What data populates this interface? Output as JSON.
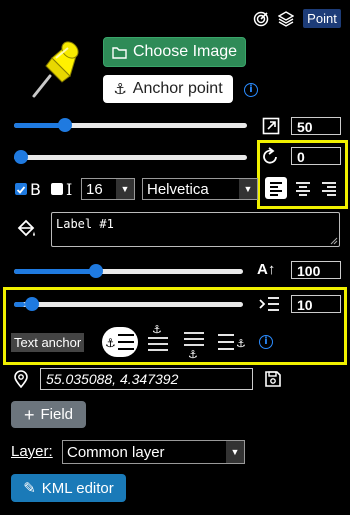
{
  "header": {
    "point_badge": "Point"
  },
  "image": {
    "choose_label": "Choose Image",
    "anchor_label": "Anchor point"
  },
  "size": {
    "value": "50",
    "level": 0.2
  },
  "rotation": {
    "value": "0",
    "level": 0.0
  },
  "font": {
    "bold_label": "B",
    "italic_label": "I",
    "bold_checked": true,
    "italic_checked": false,
    "size": "16",
    "family": "Helvetica",
    "align_selected": "left"
  },
  "label": {
    "text": "Label #1"
  },
  "scale": {
    "value": "100",
    "level": 0.35
  },
  "indent": {
    "value": "10",
    "level": 0.05
  },
  "anchor": {
    "label": "Text anchor",
    "selected": "left"
  },
  "coords": {
    "value": "55.035088, 4.347392"
  },
  "field_button": "Field",
  "layer": {
    "label": "Layer:",
    "value": "Common layer"
  },
  "kml_button": "KML editor",
  "colors": {
    "accent": "#1f7ae0",
    "highlight": "#f0f000",
    "green": "#2e8b57"
  }
}
